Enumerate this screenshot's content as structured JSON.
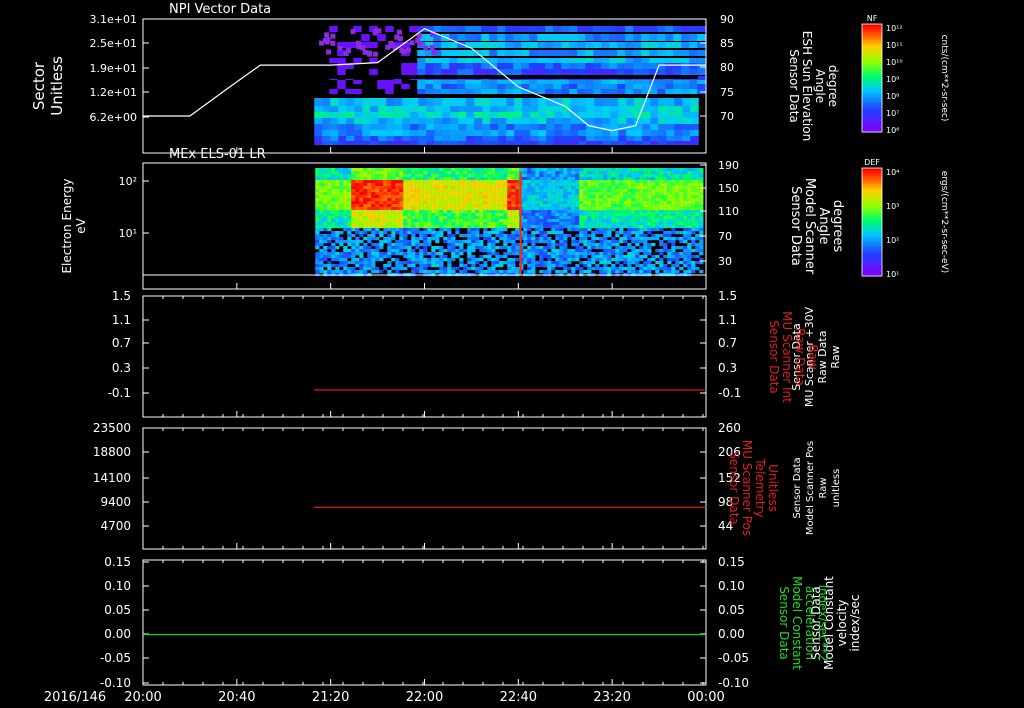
{
  "chart_data": [
    {
      "type": "heatmap",
      "title": "NPI Vector Data",
      "ylabel_left": [
        "Sector",
        "Unitless"
      ],
      "ylabel_right": [
        "Sensor Data",
        "ESH Sun Elevation",
        "Angle",
        "degree"
      ],
      "left_ticks": [
        "3.1e+01",
        "2.5e+01",
        "1.9e+01",
        "1.2e+01",
        "6.2e+00"
      ],
      "right_ticks": [
        "90",
        "85",
        "80",
        "75",
        "70"
      ],
      "right_ylim": [
        66,
        90
      ],
      "line_series": {
        "name": "ESH Sun Elevation Angle",
        "x": [
          "20:00",
          "20:20",
          "20:37",
          "20:50",
          "21:20",
          "21:40",
          "22:00",
          "22:20",
          "22:40",
          "23:00",
          "23:10",
          "23:20",
          "23:30",
          "23:40",
          "00:00"
        ],
        "y": [
          70,
          70,
          76,
          80.5,
          80.5,
          81,
          88,
          84,
          76,
          72,
          68,
          67,
          68,
          80.5,
          80.5
        ]
      },
      "colorbar": {
        "label": "NF",
        "unit": "cnts/(cm**2-sr-sec)",
        "ticks": [
          "10¹²",
          "10¹¹",
          "10¹⁰",
          "10⁹",
          "10⁸",
          "10⁷",
          "10⁶"
        ]
      }
    },
    {
      "type": "heatmap",
      "title": "MEx ELS-01 LR",
      "ylabel_left": [
        "Electron Energy",
        "eV"
      ],
      "ylabel_right": [
        "Sensor Data",
        "Model Scanner",
        "Angle",
        "degrees"
      ],
      "left_ticks": [
        "10²",
        "10¹"
      ],
      "right_ticks": [
        "190",
        "150",
        "110",
        "70",
        "30"
      ],
      "colorbar": {
        "label": "DEF",
        "unit": "ergs/(cm**2-sr-sec-eV)",
        "ticks": [
          "10⁴",
          "10³",
          "10²",
          "10¹"
        ]
      }
    },
    {
      "type": "line",
      "ylabel_left": [
        "Sensor Data",
        "MU Scanner +30V",
        "Raw Data",
        "Raw"
      ],
      "ylabel_right": [
        "Sensor Data",
        "MU Scanner Int",
        "Raw Data",
        "Raw"
      ],
      "left_ticks": [
        "1.5",
        "1.1",
        "0.7",
        "0.3",
        "-0.1"
      ],
      "right_ticks": [
        "1.5",
        "1.1",
        "0.7",
        "0.3",
        "-0.1"
      ],
      "ylim": [
        -0.3,
        1.5
      ],
      "series": [
        {
          "name": "MU Scanner Int",
          "color": "#e01e1e",
          "x": [
            "21:13",
            "00:00"
          ],
          "y": [
            -0.05,
            -0.05
          ]
        }
      ]
    },
    {
      "type": "line",
      "ylabel_left": [
        "Sensor Data",
        "Model Scanner Pos",
        "Raw",
        "unitless"
      ],
      "ylabel_right": [
        "Sensor Data",
        "MU Scanner Pos",
        "Telemetry",
        "Unitless"
      ],
      "left_ticks": [
        "23500",
        "18800",
        "14100",
        "9400",
        "4700"
      ],
      "right_ticks": [
        "260",
        "206",
        "152",
        "98",
        "44"
      ],
      "ylim": [
        0,
        23500
      ],
      "series": [
        {
          "name": "MU Scanner Pos",
          "color": "#e01e1e",
          "x": [
            "21:13",
            "00:00"
          ],
          "y": [
            8300,
            8300
          ]
        }
      ]
    },
    {
      "type": "line",
      "ylabel_left": [
        "Sensor Data",
        "Model Constant",
        "velocity",
        "index/sec"
      ],
      "ylabel_right": [
        "Sensor Data",
        "Model Constant",
        "acceleration",
        "index/sec**2"
      ],
      "left_ticks": [
        "0.15",
        "0.10",
        "0.05",
        "0.00",
        "-0.05",
        "-0.10"
      ],
      "right_ticks": [
        "0.15",
        "0.10",
        "0.05",
        "0.00",
        "-0.05",
        "-0.10"
      ],
      "ylim": [
        -0.1,
        0.15
      ],
      "series": [
        {
          "name": "Model Constant acceleration",
          "color": "#22cc22",
          "x": [
            "20:00",
            "00:00"
          ],
          "y": [
            0,
            0
          ]
        }
      ]
    }
  ],
  "x_axis": {
    "date": "2016/146",
    "ticks": [
      "20:00",
      "20:40",
      "21:20",
      "22:00",
      "22:40",
      "23:20",
      "00:00"
    ]
  }
}
